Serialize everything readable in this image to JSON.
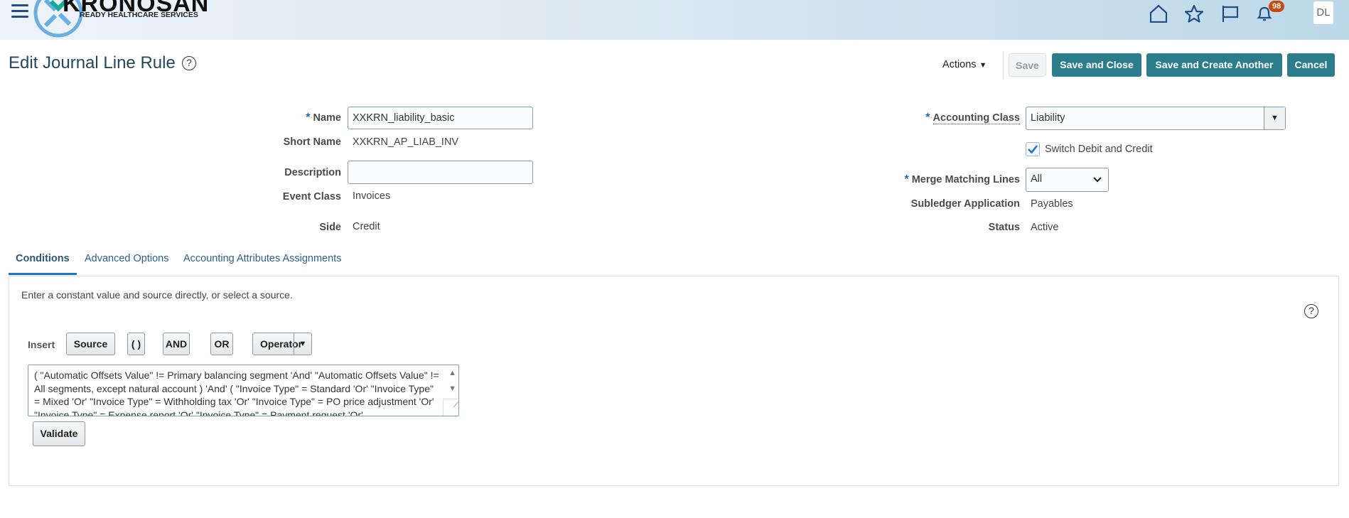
{
  "header": {
    "logo_name": "KRONOSAN",
    "logo_tagline": "READY HEALTHCARE SERVICES",
    "notification_count": "98",
    "user_initials": "DL"
  },
  "page": {
    "title": "Edit Journal Line Rule",
    "help": "?"
  },
  "toolbar": {
    "actions": "Actions",
    "save": "Save",
    "save_close": "Save and Close",
    "save_create": "Save and Create Another",
    "cancel": "Cancel"
  },
  "form": {
    "name_label": "Name",
    "name_value": "XXKRN_liability_basic",
    "short_name_label": "Short Name",
    "short_name_value": "XXKRN_AP_LIAB_INV",
    "description_label": "Description",
    "description_value": "",
    "event_class_label": "Event Class",
    "event_class_value": "Invoices",
    "side_label": "Side",
    "side_value": "Credit",
    "accounting_class_label": "Accounting Class",
    "accounting_class_value": "Liability",
    "switch_label": "Switch Debit and Credit",
    "switch_checked": true,
    "merge_label": "Merge Matching Lines",
    "merge_value": "All",
    "subledger_label": "Subledger Application",
    "subledger_value": "Payables",
    "status_label": "Status",
    "status_value": "Active"
  },
  "tabs": [
    {
      "label": "Conditions",
      "active": true
    },
    {
      "label": "Advanced Options"
    },
    {
      "label": "Accounting Attributes Assignments"
    }
  ],
  "conditions": {
    "hint": "Enter a constant value and source directly, or select a source.",
    "help": "?",
    "insert_label": "Insert",
    "source": "Source",
    "parens": "( )",
    "and": "AND",
    "or": "OR",
    "operator": "Operator",
    "expression": " ( \"Automatic Offsets Value\" != Primary balancing segment 'And' \"Automatic Offsets Value\" != All segments, except natural account ) 'And' ( \"Invoice Type\" = Standard 'Or' \"Invoice Type\" = Mixed 'Or' \"Invoice Type\" = Withholding tax 'Or' \"Invoice Type\" = PO price adjustment 'Or' \"Invoice Type\" = Expense report 'Or' \"Invoice Type\" = Payment request 'Or'",
    "validate": "Validate"
  }
}
